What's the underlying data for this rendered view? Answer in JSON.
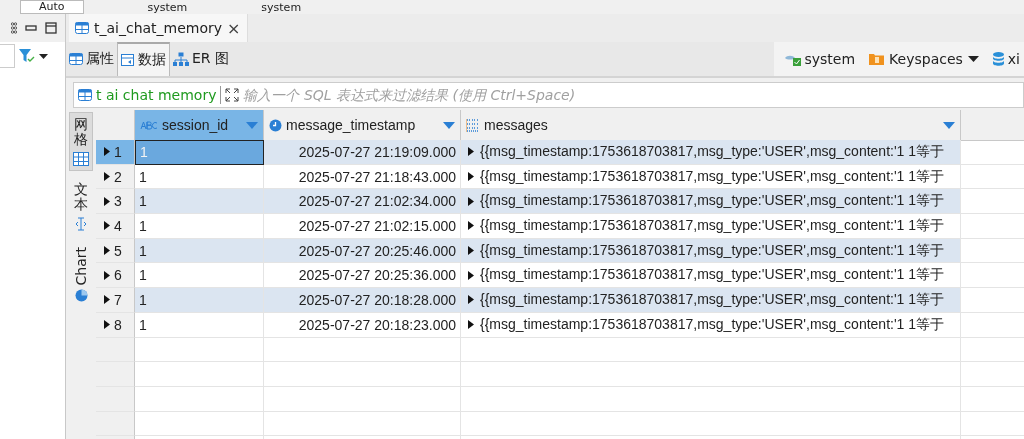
{
  "toolbar": {
    "mode_value": "Auto",
    "connection": "system",
    "schema": "system"
  },
  "editor_tab": {
    "title": "t_ai_chat_memory",
    "close": "×"
  },
  "view_tabs": [
    {
      "label": "属性",
      "selected": false,
      "kind": "table"
    },
    {
      "label": "数据",
      "selected": true,
      "kind": "data"
    },
    {
      "label": "ER 图",
      "selected": false,
      "kind": "er"
    }
  ],
  "context": {
    "connection": "system",
    "keyspaces": "Keyspaces",
    "database": "xi"
  },
  "filter": {
    "table": "t ai chat memory",
    "placeholder": "输入一个 SQL 表达式来过滤结果 (使用 Ctrl+Space)"
  },
  "side_tabs": [
    {
      "label": "网格",
      "selected": true,
      "kind": "grid"
    },
    {
      "label": "文本",
      "selected": false,
      "kind": "text"
    },
    {
      "label": "Chart",
      "selected": false,
      "kind": "chart"
    }
  ],
  "table": {
    "columns": [
      {
        "name": "session_id",
        "kind": "text"
      },
      {
        "name": "message_timestamp",
        "kind": "time"
      },
      {
        "name": "messages",
        "kind": "list"
      }
    ],
    "rows": [
      {
        "number": "1",
        "selected": true,
        "session_id": "1",
        "message_timestamp": "2025-07-27 21:19:09.000",
        "messages": "{{msg_timestamp:1753618703817,msg_type:'USER',msg_content:'1 1等于"
      },
      {
        "number": "2",
        "selected": false,
        "session_id": "1",
        "message_timestamp": "2025-07-27 21:18:43.000",
        "messages": "{{msg_timestamp:1753618703817,msg_type:'USER',msg_content:'1 1等于"
      },
      {
        "number": "3",
        "selected": false,
        "session_id": "1",
        "message_timestamp": "2025-07-27 21:02:34.000",
        "messages": "{{msg_timestamp:1753618703817,msg_type:'USER',msg_content:'1 1等于"
      },
      {
        "number": "4",
        "selected": false,
        "session_id": "1",
        "message_timestamp": "2025-07-27 21:02:15.000",
        "messages": "{{msg_timestamp:1753618703817,msg_type:'USER',msg_content:'1 1等于"
      },
      {
        "number": "5",
        "selected": false,
        "session_id": "1",
        "message_timestamp": "2025-07-27 20:25:46.000",
        "messages": "{{msg_timestamp:1753618703817,msg_type:'USER',msg_content:'1 1等于"
      },
      {
        "number": "6",
        "selected": false,
        "session_id": "1",
        "message_timestamp": "2025-07-27 20:25:36.000",
        "messages": "{{msg_timestamp:1753618703817,msg_type:'USER',msg_content:'1 1等于"
      },
      {
        "number": "7",
        "selected": false,
        "session_id": "1",
        "message_timestamp": "2025-07-27 20:18:28.000",
        "messages": "{{msg_timestamp:1753618703817,msg_type:'USER',msg_content:'1 1等于"
      },
      {
        "number": "8",
        "selected": false,
        "session_id": "1",
        "message_timestamp": "2025-07-27 20:18:23.000",
        "messages": "{{msg_timestamp:1753618703817,msg_type:'USER',msg_content:'1 1等于"
      }
    ]
  }
}
